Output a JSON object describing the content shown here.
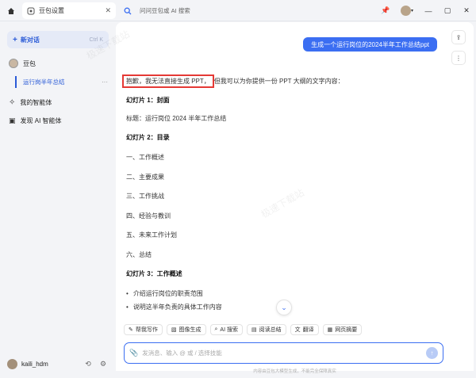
{
  "titlebar": {
    "tab_title": "豆包设置",
    "search_placeholder": "问问豆包或 AI 搜索"
  },
  "sidebar": {
    "new_chat_label": "新对话",
    "new_chat_shortcut": "Ctrl K",
    "bot_name": "豆包",
    "active_conversation": "运行岗半年总结",
    "my_agents": "我的智能体",
    "discover_agents": "发现 AI 智能体",
    "username": "kaili_hdm"
  },
  "chat": {
    "user_message": "生成一个运行岗位的2024半年工作总结ppt",
    "answer_intro_highlight": "抱歉，我无法直接生成 PPT，",
    "answer_intro_rest": "但我可以为你提供一份 PPT 大纲的文字内容：",
    "slide1_heading": "幻灯片 1：封面",
    "slide1_title": "标题：运行岗位 2024 半年工作总结",
    "slide2_heading": "幻灯片 2：目录",
    "toc": [
      "一、工作概述",
      "二、主要成果",
      "三、工作挑战",
      "四、经验与教训",
      "五、未来工作计划",
      "六、总结"
    ],
    "slide3_heading": "幻灯片 3：工作概述",
    "slide3_bullets": [
      "介绍运行岗位的职责范围",
      "说明这半年负责的具体工作内容"
    ]
  },
  "quick_actions": [
    "帮我写作",
    "图像生成",
    "AI 搜索",
    "阅读总结",
    "翻译",
    "网页摘要"
  ],
  "input": {
    "placeholder": "发消息、输入 @ 或 / 选择技能"
  },
  "footer_text": "内容由豆包大模型生成，不能完全保障真实",
  "watermark": "极速下载站",
  "colors": {
    "accent": "#3b6ef2",
    "highlight_border": "#e53935"
  }
}
